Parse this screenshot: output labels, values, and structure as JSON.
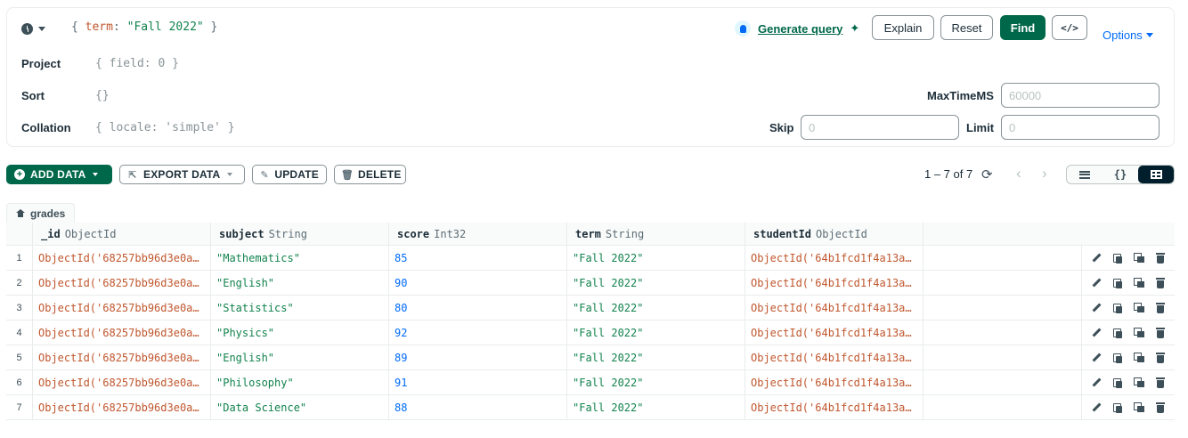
{
  "query": {
    "filter_brace_open": "{",
    "filter_key": "term",
    "filter_colon": ":",
    "filter_value": "\"Fall 2022\"",
    "filter_brace_close": "}",
    "project_label": "Project",
    "project_value": "{ field: 0 }",
    "sort_label": "Sort",
    "sort_value": "{}",
    "collation_label": "Collation",
    "collation_value": "{ locale: 'simple' }",
    "generate_label": "Generate query",
    "explain_label": "Explain",
    "reset_label": "Reset",
    "find_label": "Find",
    "code_label": "</>",
    "options_label": "Options",
    "maxtime_label": "MaxTimeMS",
    "maxtime_placeholder": "60000",
    "skip_label": "Skip",
    "skip_placeholder": "0",
    "limit_label": "Limit",
    "limit_placeholder": "0"
  },
  "toolbar": {
    "add_data_label": "ADD DATA",
    "export_data_label": "EXPORT DATA",
    "update_label": "UPDATE",
    "delete_label": "DELETE",
    "pager_text": "1 – 7 of 7",
    "view_json_label": "{}"
  },
  "collection": {
    "name": "grades"
  },
  "table": {
    "columns": [
      {
        "name": "_id",
        "type": "ObjectId"
      },
      {
        "name": "subject",
        "type": "String"
      },
      {
        "name": "score",
        "type": "Int32"
      },
      {
        "name": "term",
        "type": "String"
      },
      {
        "name": "studentId",
        "type": "ObjectId"
      }
    ],
    "rows": [
      {
        "idx": "1",
        "id": "ObjectId('68257bb96d3e0a…",
        "subject": "\"Mathematics\"",
        "score": "85",
        "term": "\"Fall 2022\"",
        "studentId": "ObjectId('64b1fcd1f4a13a…"
      },
      {
        "idx": "2",
        "id": "ObjectId('68257bb96d3e0a…",
        "subject": "\"English\"",
        "score": "90",
        "term": "\"Fall 2022\"",
        "studentId": "ObjectId('64b1fcd1f4a13a…"
      },
      {
        "idx": "3",
        "id": "ObjectId('68257bb96d3e0a…",
        "subject": "\"Statistics\"",
        "score": "80",
        "term": "\"Fall 2022\"",
        "studentId": "ObjectId('64b1fcd1f4a13a…"
      },
      {
        "idx": "4",
        "id": "ObjectId('68257bb96d3e0a…",
        "subject": "\"Physics\"",
        "score": "92",
        "term": "\"Fall 2022\"",
        "studentId": "ObjectId('64b1fcd1f4a13a…"
      },
      {
        "idx": "5",
        "id": "ObjectId('68257bb96d3e0a…",
        "subject": "\"English\"",
        "score": "89",
        "term": "\"Fall 2022\"",
        "studentId": "ObjectId('64b1fcd1f4a13a…"
      },
      {
        "idx": "6",
        "id": "ObjectId('68257bb96d3e0a…",
        "subject": "\"Philosophy\"",
        "score": "91",
        "term": "\"Fall 2022\"",
        "studentId": "ObjectId('64b1fcd1f4a13a…"
      },
      {
        "idx": "7",
        "id": "ObjectId('68257bb96d3e0a…",
        "subject": "\"Data Science\"",
        "score": "88",
        "term": "\"Fall 2022\"",
        "studentId": "ObjectId('64b1fcd1f4a13a…"
      }
    ]
  },
  "colors": {
    "brand_green": "#00684a",
    "objectid": "#c0572e",
    "string": "#12824d",
    "number": "#016bf8",
    "link_blue": "#016bf8"
  },
  "icons": [
    "history-icon",
    "lightbulb-icon",
    "sparkle-icon",
    "refresh-icon",
    "home-icon",
    "edit-icon",
    "copy-icon",
    "clone-icon",
    "trash-icon"
  ]
}
